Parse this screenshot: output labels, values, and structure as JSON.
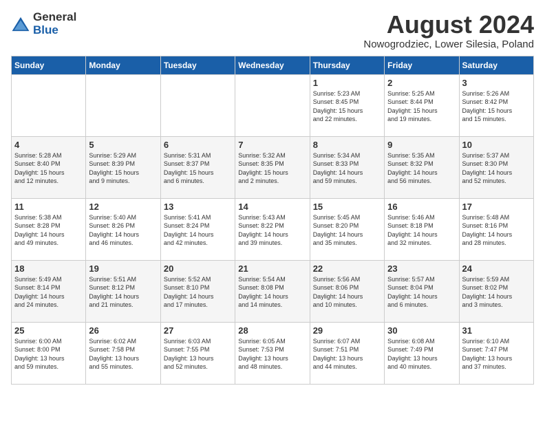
{
  "logo": {
    "text_general": "General",
    "text_blue": "Blue"
  },
  "title": "August 2024",
  "subtitle": "Nowogrodziec, Lower Silesia, Poland",
  "days_of_week": [
    "Sunday",
    "Monday",
    "Tuesday",
    "Wednesday",
    "Thursday",
    "Friday",
    "Saturday"
  ],
  "weeks": [
    [
      {
        "day": "",
        "info": ""
      },
      {
        "day": "",
        "info": ""
      },
      {
        "day": "",
        "info": ""
      },
      {
        "day": "",
        "info": ""
      },
      {
        "day": "1",
        "info": "Sunrise: 5:23 AM\nSunset: 8:45 PM\nDaylight: 15 hours\nand 22 minutes."
      },
      {
        "day": "2",
        "info": "Sunrise: 5:25 AM\nSunset: 8:44 PM\nDaylight: 15 hours\nand 19 minutes."
      },
      {
        "day": "3",
        "info": "Sunrise: 5:26 AM\nSunset: 8:42 PM\nDaylight: 15 hours\nand 15 minutes."
      }
    ],
    [
      {
        "day": "4",
        "info": "Sunrise: 5:28 AM\nSunset: 8:40 PM\nDaylight: 15 hours\nand 12 minutes."
      },
      {
        "day": "5",
        "info": "Sunrise: 5:29 AM\nSunset: 8:39 PM\nDaylight: 15 hours\nand 9 minutes."
      },
      {
        "day": "6",
        "info": "Sunrise: 5:31 AM\nSunset: 8:37 PM\nDaylight: 15 hours\nand 6 minutes."
      },
      {
        "day": "7",
        "info": "Sunrise: 5:32 AM\nSunset: 8:35 PM\nDaylight: 15 hours\nand 2 minutes."
      },
      {
        "day": "8",
        "info": "Sunrise: 5:34 AM\nSunset: 8:33 PM\nDaylight: 14 hours\nand 59 minutes."
      },
      {
        "day": "9",
        "info": "Sunrise: 5:35 AM\nSunset: 8:32 PM\nDaylight: 14 hours\nand 56 minutes."
      },
      {
        "day": "10",
        "info": "Sunrise: 5:37 AM\nSunset: 8:30 PM\nDaylight: 14 hours\nand 52 minutes."
      }
    ],
    [
      {
        "day": "11",
        "info": "Sunrise: 5:38 AM\nSunset: 8:28 PM\nDaylight: 14 hours\nand 49 minutes."
      },
      {
        "day": "12",
        "info": "Sunrise: 5:40 AM\nSunset: 8:26 PM\nDaylight: 14 hours\nand 46 minutes."
      },
      {
        "day": "13",
        "info": "Sunrise: 5:41 AM\nSunset: 8:24 PM\nDaylight: 14 hours\nand 42 minutes."
      },
      {
        "day": "14",
        "info": "Sunrise: 5:43 AM\nSunset: 8:22 PM\nDaylight: 14 hours\nand 39 minutes."
      },
      {
        "day": "15",
        "info": "Sunrise: 5:45 AM\nSunset: 8:20 PM\nDaylight: 14 hours\nand 35 minutes."
      },
      {
        "day": "16",
        "info": "Sunrise: 5:46 AM\nSunset: 8:18 PM\nDaylight: 14 hours\nand 32 minutes."
      },
      {
        "day": "17",
        "info": "Sunrise: 5:48 AM\nSunset: 8:16 PM\nDaylight: 14 hours\nand 28 minutes."
      }
    ],
    [
      {
        "day": "18",
        "info": "Sunrise: 5:49 AM\nSunset: 8:14 PM\nDaylight: 14 hours\nand 24 minutes."
      },
      {
        "day": "19",
        "info": "Sunrise: 5:51 AM\nSunset: 8:12 PM\nDaylight: 14 hours\nand 21 minutes."
      },
      {
        "day": "20",
        "info": "Sunrise: 5:52 AM\nSunset: 8:10 PM\nDaylight: 14 hours\nand 17 minutes."
      },
      {
        "day": "21",
        "info": "Sunrise: 5:54 AM\nSunset: 8:08 PM\nDaylight: 14 hours\nand 14 minutes."
      },
      {
        "day": "22",
        "info": "Sunrise: 5:56 AM\nSunset: 8:06 PM\nDaylight: 14 hours\nand 10 minutes."
      },
      {
        "day": "23",
        "info": "Sunrise: 5:57 AM\nSunset: 8:04 PM\nDaylight: 14 hours\nand 6 minutes."
      },
      {
        "day": "24",
        "info": "Sunrise: 5:59 AM\nSunset: 8:02 PM\nDaylight: 14 hours\nand 3 minutes."
      }
    ],
    [
      {
        "day": "25",
        "info": "Sunrise: 6:00 AM\nSunset: 8:00 PM\nDaylight: 13 hours\nand 59 minutes."
      },
      {
        "day": "26",
        "info": "Sunrise: 6:02 AM\nSunset: 7:58 PM\nDaylight: 13 hours\nand 55 minutes."
      },
      {
        "day": "27",
        "info": "Sunrise: 6:03 AM\nSunset: 7:55 PM\nDaylight: 13 hours\nand 52 minutes."
      },
      {
        "day": "28",
        "info": "Sunrise: 6:05 AM\nSunset: 7:53 PM\nDaylight: 13 hours\nand 48 minutes."
      },
      {
        "day": "29",
        "info": "Sunrise: 6:07 AM\nSunset: 7:51 PM\nDaylight: 13 hours\nand 44 minutes."
      },
      {
        "day": "30",
        "info": "Sunrise: 6:08 AM\nSunset: 7:49 PM\nDaylight: 13 hours\nand 40 minutes."
      },
      {
        "day": "31",
        "info": "Sunrise: 6:10 AM\nSunset: 7:47 PM\nDaylight: 13 hours\nand 37 minutes."
      }
    ]
  ]
}
